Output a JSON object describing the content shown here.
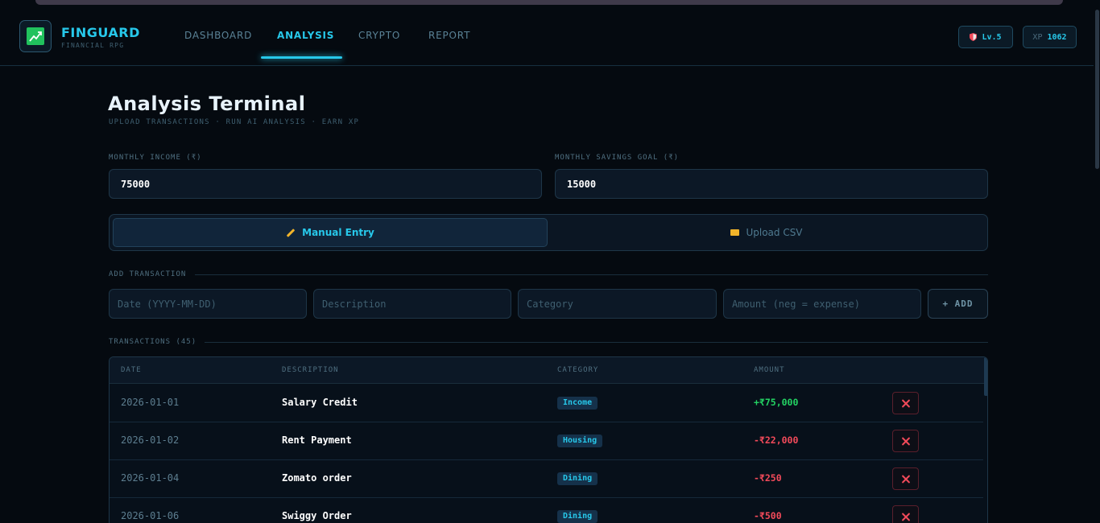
{
  "header": {
    "brand": "FINGUARD",
    "brand_sub": "FINANCIAL RPG",
    "nav": [
      {
        "label": "DASHBOARD",
        "active": false
      },
      {
        "label": "ANALYSIS",
        "active": true
      },
      {
        "label": "CRYPTO",
        "active": false
      },
      {
        "label": "REPORT",
        "active": false
      }
    ],
    "level": "Lv.5",
    "xp_label": "XP",
    "xp_value": "1062"
  },
  "page": {
    "title": "Analysis Terminal",
    "subtitle": "UPLOAD TRANSACTIONS · RUN AI ANALYSIS · EARN XP"
  },
  "inputs": {
    "income_label": "MONTHLY INCOME (₹)",
    "income_value": "75000",
    "savings_label": "MONTHLY SAVINGS GOAL (₹)",
    "savings_value": "15000"
  },
  "modes": {
    "manual": "Manual Entry",
    "csv": "Upload CSV"
  },
  "add_transaction": {
    "section_label": "ADD TRANSACTION",
    "date_placeholder": "Date (YYYY-MM-DD)",
    "description_placeholder": "Description",
    "category_placeholder": "Category",
    "amount_placeholder": "Amount (neg = expense)",
    "add_button": "+ ADD"
  },
  "transactions": {
    "section_label": "TRANSACTIONS (45)",
    "columns": [
      "DATE",
      "DESCRIPTION",
      "CATEGORY",
      "AMOUNT"
    ],
    "rows": [
      {
        "date": "2026-01-01",
        "description": "Salary Credit",
        "category": "Income",
        "amount": "+₹75,000",
        "type": "pos"
      },
      {
        "date": "2026-01-02",
        "description": "Rent Payment",
        "category": "Housing",
        "amount": "-₹22,000",
        "type": "neg"
      },
      {
        "date": "2026-01-04",
        "description": "Zomato order",
        "category": "Dining",
        "amount": "-₹250",
        "type": "neg"
      },
      {
        "date": "2026-01-06",
        "description": "Swiggy Order",
        "category": "Dining",
        "amount": "-₹500",
        "type": "neg"
      }
    ]
  },
  "colors": {
    "accent": "#27c8ea",
    "positive": "#23d363",
    "negative": "#f24a5a",
    "background": "#050a10"
  },
  "icons": {
    "logo": "chart-up-icon",
    "level": "shield-icon",
    "manual": "pencil-icon",
    "csv": "folder-icon",
    "delete": "close-icon"
  }
}
